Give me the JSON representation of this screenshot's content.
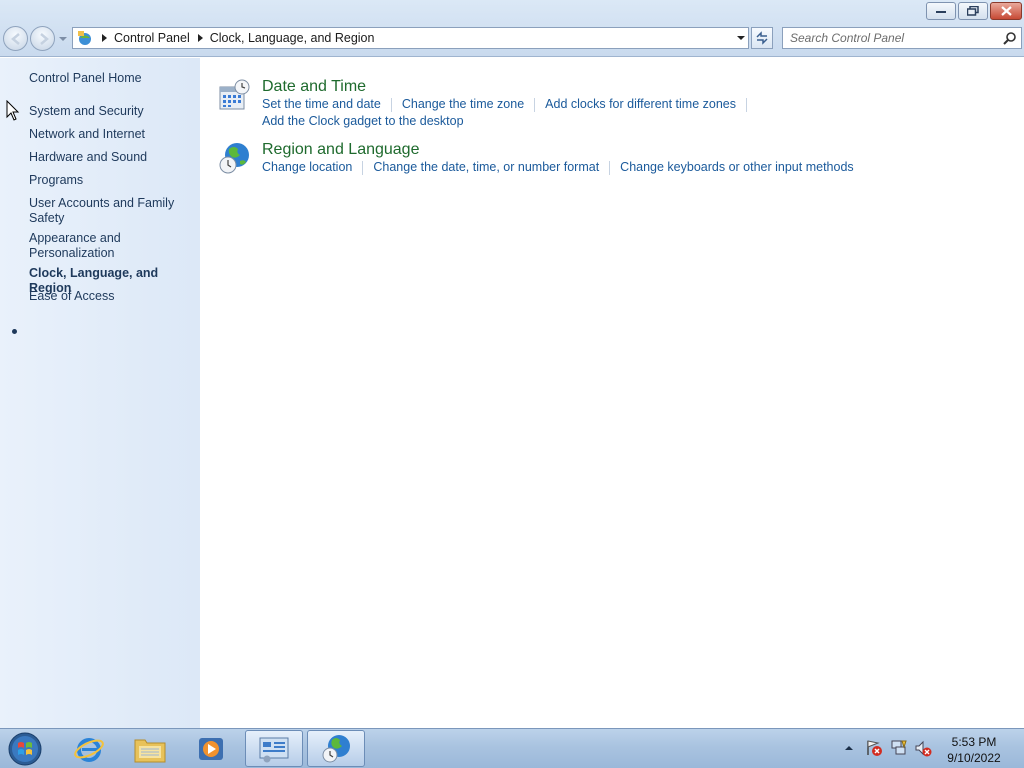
{
  "window": {
    "caption_buttons": [
      "minimize",
      "restore",
      "close"
    ]
  },
  "nav": {
    "breadcrumbs": [
      "Control Panel",
      "Clock, Language, and Region"
    ]
  },
  "search": {
    "placeholder": "Search Control Panel"
  },
  "sidebar": {
    "items": [
      {
        "label": "Control Panel Home"
      },
      {
        "label": "System and Security"
      },
      {
        "label": "Network and Internet"
      },
      {
        "label": "Hardware and Sound"
      },
      {
        "label": "Programs"
      },
      {
        "label": "User Accounts and Family Safety"
      },
      {
        "label": "Appearance and Personalization"
      },
      {
        "label": "Clock, Language, and Region",
        "active": true
      },
      {
        "label": "Ease of Access"
      }
    ]
  },
  "categories": [
    {
      "title": "Date and Time",
      "icon": "clock-calendar-icon",
      "links": [
        "Set the time and date",
        "Change the time zone",
        "Add clocks for different time zones"
      ],
      "extra_link": "Add the Clock gadget to the desktop"
    },
    {
      "title": "Region and Language",
      "icon": "globe-clock-icon",
      "links": [
        "Change location",
        "Change the date, time, or number format",
        "Change keyboards or other input methods"
      ]
    }
  ],
  "taskbar": {
    "apps": [
      "internet-explorer-icon",
      "windows-explorer-icon",
      "media-player-icon",
      "control-panel-icon",
      "region-language-icon"
    ],
    "tray_icons": [
      "action-center-icon",
      "network-icon",
      "volume-muted-icon"
    ],
    "time": "5:53 PM",
    "date": "9/10/2022"
  },
  "colors": {
    "link": "#1b5a9b",
    "category_title": "#1e6a2d",
    "sidebar_text": "#1e395b"
  }
}
